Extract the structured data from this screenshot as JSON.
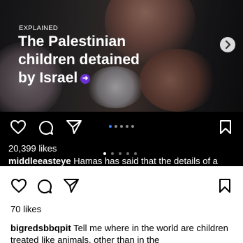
{
  "post1": {
    "tag": "EXPLAINED",
    "headline": "The Palestinian children detained by Israel",
    "likes": "20,399 likes",
    "username": "middleeasteye",
    "caption": "Hamas has said that the details of a"
  },
  "post2": {
    "likes": "70 likes",
    "username": "bigredsbbqpit",
    "caption": "Tell me where in the world are children treated like animals, other than in the"
  },
  "carousel": {
    "image_dot_count": 5,
    "image_active_index": 0,
    "caption_dot_count": 5,
    "caption_active_index": 0
  },
  "icons": {
    "like": "heart-icon",
    "comment": "comment-icon",
    "share": "send-icon",
    "save": "bookmark-icon",
    "next": "chevron-right-icon"
  },
  "colors": {
    "badge": "#6b2fd6"
  }
}
